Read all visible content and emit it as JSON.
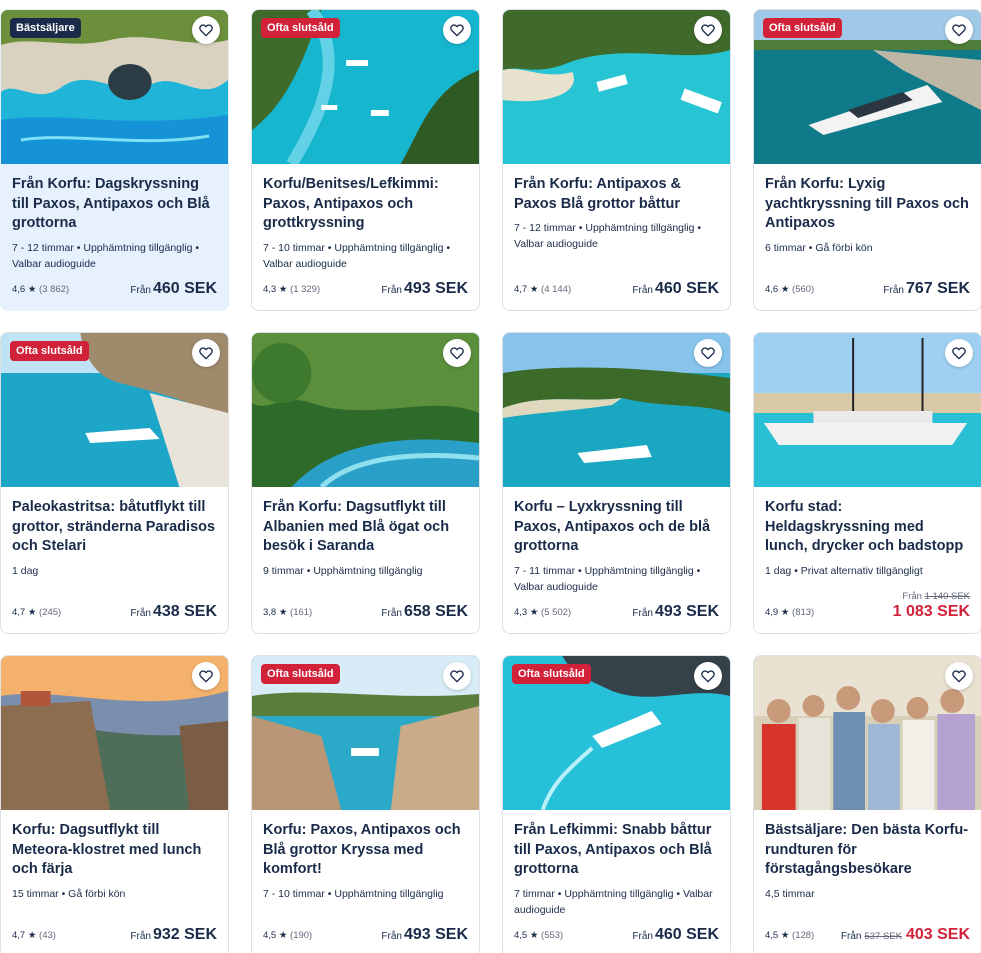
{
  "labels": {
    "from": "Från",
    "heart_icon": "heart-icon",
    "star": "★"
  },
  "colors": {
    "navy": "#1a2b49",
    "sale_red": "#d1223a",
    "highlight": "#e6f1fd"
  },
  "cards": [
    {
      "badge": "Bästsäljare",
      "badge_type": "bestseller",
      "title": "Från Korfu: Dagskryssning till Paxos, Antipaxos och Blå grottorna",
      "meta": "7 - 12 timmar • Upphämtning tillgänglig • Valbar audioguide",
      "rating": "4,6",
      "reviews": "(3 862)",
      "price": "460 SEK",
      "old_price": "",
      "highlight": true,
      "sale": false,
      "scene": "cave"
    },
    {
      "badge": "Ofta slutsåld",
      "badge_type": "soldout",
      "title": "Korfu/Benitses/Lefkimmi: Paxos, Antipaxos och grottkryssning",
      "meta": "7 - 10 timmar • Upphämtning tillgänglig • Valbar audioguide",
      "rating": "4,3",
      "reviews": "(1 329)",
      "price": "493 SEK",
      "old_price": "",
      "highlight": false,
      "sale": false,
      "scene": "aerial"
    },
    {
      "badge": "",
      "badge_type": "",
      "title": "Från Korfu: Antipaxos & Paxos Blå grottor båttur",
      "meta": "7 - 12 timmar • Upphämtning tillgänglig • Valbar audioguide",
      "rating": "4,7",
      "reviews": "(4 144)",
      "price": "460 SEK",
      "old_price": "",
      "highlight": false,
      "sale": false,
      "scene": "bay"
    },
    {
      "badge": "Ofta slutsåld",
      "badge_type": "soldout",
      "title": "Från Korfu: Lyxig yachtkryssning till Paxos och Antipaxos",
      "meta": "6 timmar • Gå förbi kön",
      "rating": "4,6",
      "reviews": "(560)",
      "price": "767 SEK",
      "old_price": "",
      "highlight": false,
      "sale": false,
      "scene": "yacht"
    },
    {
      "badge": "Ofta slutsåld",
      "badge_type": "soldout",
      "title": "Paleokastritsa: båtutflykt till grottor, stränderna Paradisos och Stelari",
      "meta": "1 dag",
      "rating": "4,7",
      "reviews": "(245)",
      "price": "438 SEK",
      "old_price": "",
      "highlight": false,
      "sale": false,
      "scene": "cliff"
    },
    {
      "badge": "",
      "badge_type": "",
      "title": "Från Korfu: Dagsutflykt till Albanien med Blå ögat och besök i Saranda",
      "meta": "9 timmar • Upphämtning tillgänglig",
      "rating": "3,8",
      "reviews": "(161)",
      "price": "658 SEK",
      "old_price": "",
      "highlight": false,
      "sale": false,
      "scene": "forest"
    },
    {
      "badge": "",
      "badge_type": "",
      "title": "Korfu – Lyxkryssning till Paxos, Antipaxos och de blå grottorna",
      "meta": "7 - 11 timmar • Upphämtning tillgänglig • Valbar audioguide",
      "rating": "4,3",
      "reviews": "(5 502)",
      "price": "493 SEK",
      "old_price": "",
      "highlight": false,
      "sale": false,
      "scene": "cove"
    },
    {
      "badge": "",
      "badge_type": "",
      "title": "Korfu stad: Heldagskryssning med lunch, drycker och badstopp",
      "meta": "1 dag • Privat alternativ tillgängligt",
      "rating": "4,9",
      "reviews": "(813)",
      "price": "1 083 SEK",
      "old_price": "1 140 SEK",
      "highlight": false,
      "sale": true,
      "scene": "sailboat"
    },
    {
      "badge": "",
      "badge_type": "",
      "title": "Korfu: Dagsutflykt till Meteora-klostret med lunch och färja",
      "meta": "15 timmar • Gå förbi kön",
      "rating": "4,7",
      "reviews": "(43)",
      "price": "932 SEK",
      "old_price": "",
      "highlight": false,
      "sale": false,
      "scene": "meteora"
    },
    {
      "badge": "Ofta slutsåld",
      "badge_type": "soldout",
      "title": "Korfu: Paxos, Antipaxos och Blå grottor Kryssa med komfort!",
      "meta": "7 - 10 timmar • Upphämtning tillgänglig",
      "rating": "4,5",
      "reviews": "(190)",
      "price": "493 SEK",
      "old_price": "",
      "highlight": false,
      "sale": false,
      "scene": "rocks"
    },
    {
      "badge": "Ofta slutsåld",
      "badge_type": "soldout",
      "title": "Från Lefkimmi: Snabb båttur till Paxos, Antipaxos och Blå grottorna",
      "meta": "7 timmar • Upphämtning tillgänglig • Valbar audioguide",
      "rating": "4,5",
      "reviews": "(553)",
      "price": "460 SEK",
      "old_price": "",
      "highlight": false,
      "sale": false,
      "scene": "speedboat"
    },
    {
      "badge": "",
      "badge_type": "",
      "title": "Bästsäljare: Den bästa Korfu-rundturen för förstagångsbesökare",
      "meta": "4,5 timmar",
      "rating": "4,5",
      "reviews": "(128)",
      "price": "403 SEK",
      "old_price": "537 SEK",
      "highlight": false,
      "sale": true,
      "scene": "people"
    }
  ]
}
